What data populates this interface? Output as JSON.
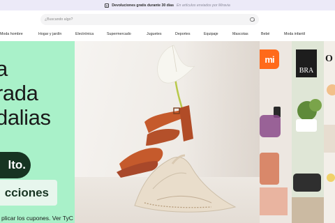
{
  "promo": {
    "icon": "box-icon",
    "strong": "Devoluciones gratis durante 30 días",
    "muted": "En artículos enviados por Miravia"
  },
  "search": {
    "placeholder": "¿Buscando algo?",
    "icon": "search-icon"
  },
  "nav": {
    "items": [
      "Moda hombre",
      "Hogar y jardín",
      "Electrónica",
      "Supermercado",
      "Juguetes",
      "Deportes",
      "Equipaje",
      "Mascotas",
      "Bebé",
      "Moda infantil"
    ]
  },
  "hero": {
    "line1": "a",
    "line2": "rada",
    "line3": "dalias",
    "button_dark": "lto.",
    "button_light": "cciones",
    "legal": "plicar los cupones. Ver TyC"
  },
  "side": {
    "tile_a_logo": "mi",
    "tile_b_logo": "BRA",
    "tile_c_logo": "O"
  },
  "colors": {
    "hero_bg": "#a9f1c9",
    "hero_button_dark": "#173422",
    "promo_bg": "#eceaf8",
    "mi_orange": "#ff6a1a",
    "sandal": "#c55a2c"
  }
}
